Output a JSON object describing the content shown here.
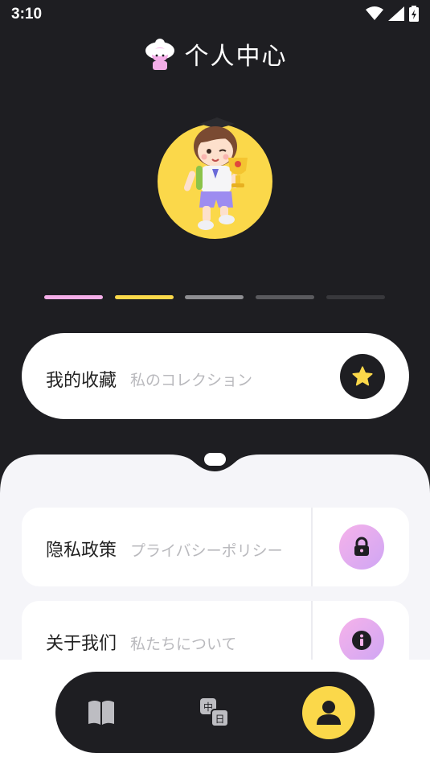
{
  "status_bar": {
    "time": "3:10",
    "icons": [
      "wifi-icon",
      "signal-icon",
      "battery-charging-icon"
    ]
  },
  "header": {
    "title": "个人中心",
    "icon": "kid-face-icon"
  },
  "avatar": {
    "background_color": "#fbd84a",
    "image": "boy-with-trophy-illustration"
  },
  "pager": {
    "indicators": [
      {
        "color": "#f4aee8"
      },
      {
        "color": "#fbd84a"
      },
      {
        "color": "#8e8e92"
      },
      {
        "color": "#5a5a5e"
      },
      {
        "color": "#38383c"
      }
    ]
  },
  "favorites_card": {
    "title": "我的收藏",
    "subtitle": "私のコレクション",
    "icon": "star-icon"
  },
  "menu": {
    "items": [
      {
        "title": "隐私政策",
        "subtitle": "プライバシーポリシー",
        "icon": "lock-icon"
      },
      {
        "title": "关于我们",
        "subtitle": "私たちについて",
        "icon": "info-icon"
      }
    ]
  },
  "bottom_nav": {
    "items": [
      {
        "name": "book-icon",
        "active": false
      },
      {
        "name": "translate-icon",
        "active": false
      },
      {
        "name": "user-icon",
        "active": true
      }
    ],
    "accent_color": "#fbd84a"
  },
  "colors": {
    "background": "#1e1e22",
    "panel": "#f5f5f9",
    "accent_yellow": "#fbd84a",
    "accent_pink": "#f6b2ea"
  }
}
